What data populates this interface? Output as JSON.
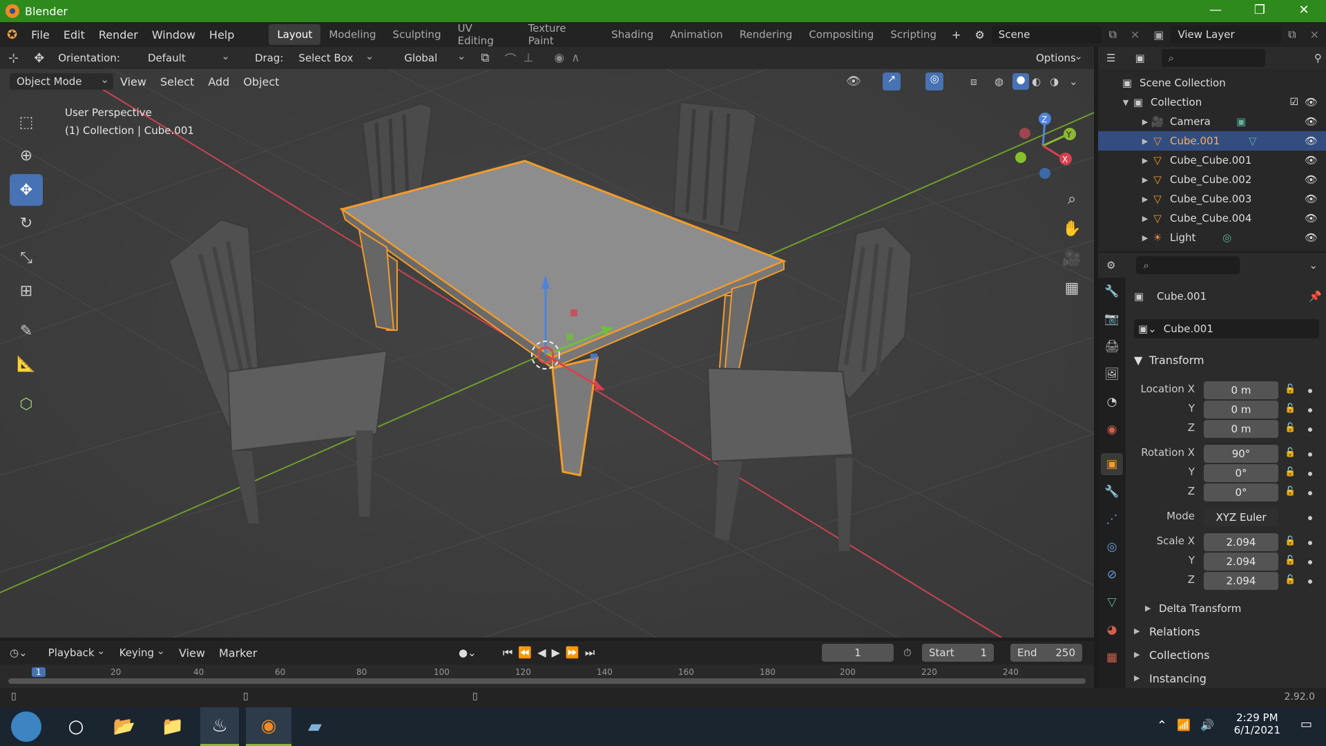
{
  "app": {
    "title": "Blender",
    "version": "2.92.0"
  },
  "window_controls": [
    "—",
    "❐",
    "✕"
  ],
  "menu": [
    "File",
    "Edit",
    "Render",
    "Window",
    "Help"
  ],
  "workspaces": [
    "Layout",
    "Modeling",
    "Sculpting",
    "UV Editing",
    "Texture Paint",
    "Shading",
    "Animation",
    "Rendering",
    "Compositing",
    "Scripting"
  ],
  "workspace_active": "Layout",
  "scene": {
    "label": "Scene"
  },
  "view_layer": {
    "label": "View Layer"
  },
  "header": {
    "orientation_label": "Orientation:",
    "orientation_value": "Default",
    "drag_label": "Drag:",
    "drag_value": "Select Box",
    "transform_value": "Global",
    "options_label": "Options"
  },
  "viewport_header": {
    "mode": "Object Mode",
    "menus": [
      "View",
      "Select",
      "Add",
      "Object"
    ]
  },
  "viewport": {
    "perspective": "User Perspective",
    "context": "(1) Collection | Cube.001"
  },
  "colors": {
    "titlebar": "#2f8a1e",
    "selection_outline": "#f39b2a",
    "x_axis": "#c94352",
    "y_axis": "#6e9e2c",
    "active_tool": "#4772b3",
    "outliner_selected": "#334d80"
  },
  "outliner": {
    "scene_collection": "Scene Collection",
    "collection": "Collection",
    "items": [
      {
        "name": "Camera",
        "icon": "camera-icon",
        "selected": false
      },
      {
        "name": "Cube.001",
        "icon": "mesh-icon",
        "selected": true
      },
      {
        "name": "Cube_Cube.001",
        "icon": "mesh-icon",
        "selected": false
      },
      {
        "name": "Cube_Cube.002",
        "icon": "mesh-icon",
        "selected": false
      },
      {
        "name": "Cube_Cube.003",
        "icon": "mesh-icon",
        "selected": false
      },
      {
        "name": "Cube_Cube.004",
        "icon": "mesh-icon",
        "selected": false
      },
      {
        "name": "Light",
        "icon": "light-icon",
        "selected": false
      }
    ]
  },
  "properties": {
    "object_name": "Cube.001",
    "object_field": "Cube.001",
    "transform_label": "Transform",
    "location": {
      "label": "Location X",
      "x": "0 m",
      "y": "0 m",
      "z": "0 m"
    },
    "rotation": {
      "label": "Rotation X",
      "x": "90°",
      "y": "0°",
      "z": "0°"
    },
    "mode": {
      "label": "Mode",
      "value": "XYZ Euler"
    },
    "scale": {
      "label": "Scale X",
      "x": "2.094",
      "y": "2.094",
      "z": "2.094"
    },
    "axis_y": "Y",
    "axis_z": "Z",
    "sections": [
      "Delta Transform",
      "Relations",
      "Collections",
      "Instancing"
    ]
  },
  "timeline": {
    "menus": [
      "Playback",
      "Keying",
      "View",
      "Marker"
    ],
    "current_frame": "1",
    "start_label": "Start",
    "start": "1",
    "end_label": "End",
    "end": "250",
    "ruler": [
      "20",
      "40",
      "60",
      "80",
      "100",
      "120",
      "140",
      "160",
      "180",
      "200",
      "220",
      "240"
    ],
    "ruler_current": "1"
  },
  "taskbar": {
    "time": "2:29 PM",
    "date": "6/1/2021"
  }
}
